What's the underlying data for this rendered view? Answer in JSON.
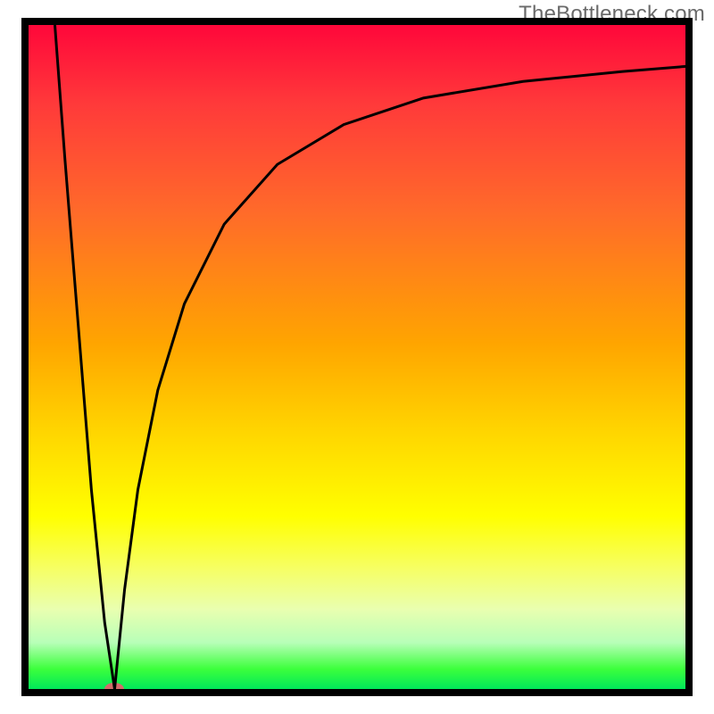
{
  "watermark": "TheBottleneck.com",
  "chart_data": {
    "type": "line",
    "title": "",
    "xlabel": "",
    "ylabel": "",
    "xlim": [
      0,
      100
    ],
    "ylim": [
      0,
      100
    ],
    "grid": false,
    "background_gradient": {
      "top_color": "#ff073a",
      "bottom_color": "#00e85a",
      "description": "vertical red→orange→yellow→green gradient"
    },
    "series": [
      {
        "name": "left-branch",
        "x": [
          4.5,
          6,
          8,
          10,
          12,
          13.5
        ],
        "values": [
          100,
          80,
          55,
          30,
          10,
          0
        ]
      },
      {
        "name": "right-branch",
        "x": [
          13.5,
          15,
          17,
          20,
          24,
          30,
          38,
          48,
          60,
          75,
          90,
          100
        ],
        "values": [
          0,
          15,
          30,
          45,
          58,
          70,
          79,
          85,
          89,
          91.5,
          93,
          93.8
        ]
      }
    ],
    "minimum_point": {
      "x": 13.5,
      "y": 0
    },
    "annotations": []
  },
  "colors": {
    "curve": "#000000",
    "frame": "#000000",
    "marker": "#d46a6a"
  }
}
